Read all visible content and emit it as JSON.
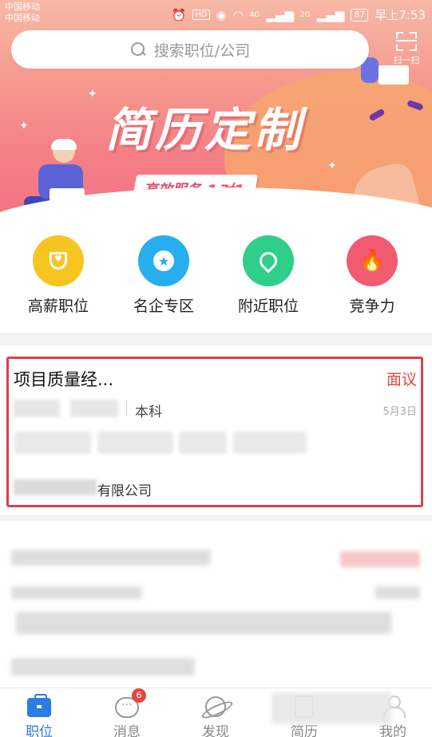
{
  "status_bar": {
    "carrier_1": "中国移动",
    "carrier_2": "中国移动",
    "hd": "HD",
    "net_1": "4G",
    "net_2": "2G",
    "battery": "87",
    "time": "早上7:53"
  },
  "search": {
    "placeholder": "搜索职位/公司",
    "scan_label": "扫一扫"
  },
  "banner": {
    "title": "简历定制",
    "subtitle": "高效服务",
    "highlight": "1对1"
  },
  "quick_entries": [
    {
      "label": "高薪职位",
      "icon": "trophy-icon",
      "color": "#f7c520"
    },
    {
      "label": "名企专区",
      "icon": "badge-icon",
      "color": "#27aef0"
    },
    {
      "label": "附近职位",
      "icon": "location-icon",
      "color": "#2fcf8b"
    },
    {
      "label": "竞争力",
      "icon": "fire-icon",
      "color": "#f25a72"
    }
  ],
  "job_card": {
    "title": "项目质量经...",
    "salary": "面议",
    "education": "本科",
    "date": "5月3日",
    "company_suffix": "有限公司"
  },
  "tabbar": [
    {
      "label": "职位",
      "icon": "briefcase-icon",
      "active": true
    },
    {
      "label": "消息",
      "icon": "message-icon",
      "badge": "6"
    },
    {
      "label": "发现",
      "icon": "planet-icon"
    },
    {
      "label": "简历",
      "icon": "resume-icon"
    },
    {
      "label": "我的",
      "icon": "user-icon"
    }
  ],
  "colors": {
    "accent": "#2a7de1",
    "salary": "#e4473e",
    "highlight_border": "#d9414a"
  }
}
